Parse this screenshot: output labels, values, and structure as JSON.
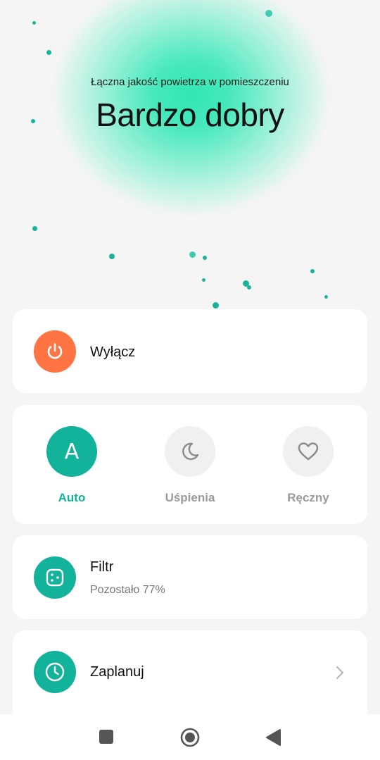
{
  "air_quality": {
    "subtitle": "Łączna jakość powietrza w pomieszczeniu",
    "status": "Bardzo dobry"
  },
  "power": {
    "label": "Wyłącz",
    "icon": "power-icon",
    "color": "#ff7443"
  },
  "modes": [
    {
      "label": "Auto",
      "icon": "A",
      "selected": true
    },
    {
      "label": "Uśpienia",
      "icon": "moon-icon",
      "selected": false
    },
    {
      "label": "Ręczny",
      "icon": "heart-icon",
      "selected": false
    }
  ],
  "filter": {
    "label": "Filtr",
    "remaining": "Pozostało 77%",
    "remaining_percent": 77,
    "icon": "filter-icon"
  },
  "schedule": {
    "label": "Zaplanuj",
    "icon": "clock-icon"
  },
  "colors": {
    "accent": "#13b29a",
    "inactive_text": "#9a9a9a",
    "inactive_circle": "#f0f0f0",
    "glow": "#2ee6b2"
  },
  "navbar": {
    "items": [
      "recent-apps-icon",
      "home-icon",
      "back-icon"
    ]
  }
}
